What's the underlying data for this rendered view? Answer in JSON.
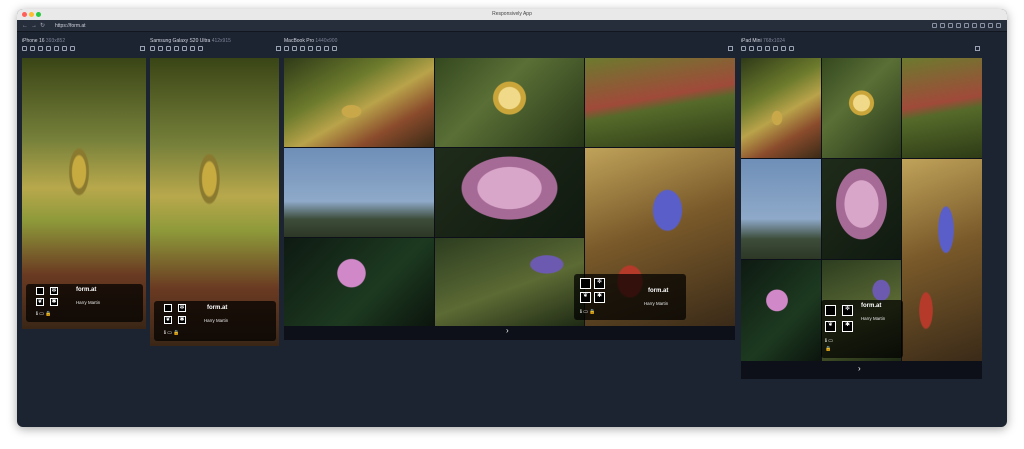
{
  "window": {
    "title": "Responsively App"
  },
  "address_bar": {
    "url": "https://form.at"
  },
  "devices": [
    {
      "name": "iPhone 16",
      "size": "393x852"
    },
    {
      "name": "Samsung Galaxy S20 Ultra",
      "size": "412x915"
    },
    {
      "name": "MacBook Pro",
      "size": "1440x900"
    },
    {
      "name": "iPad Mini",
      "size": "768x1024"
    }
  ],
  "site": {
    "title": "form.at",
    "author": "Harry Martin"
  },
  "icons": {
    "info": "info-icon",
    "card": "id-card-icon",
    "lock": "lock-icon",
    "next": "chevron-right-icon"
  },
  "glyphs": {
    "info": "ℹ",
    "card": "▭",
    "lock": "🔒",
    "next": "›",
    "flower": "✿",
    "gear": "✻",
    "leaf": "❦",
    "bug": "✱"
  },
  "colors": {
    "app_bg": "#1c2331",
    "titlebar": "#e9e9e9",
    "overlay": "#000000"
  }
}
